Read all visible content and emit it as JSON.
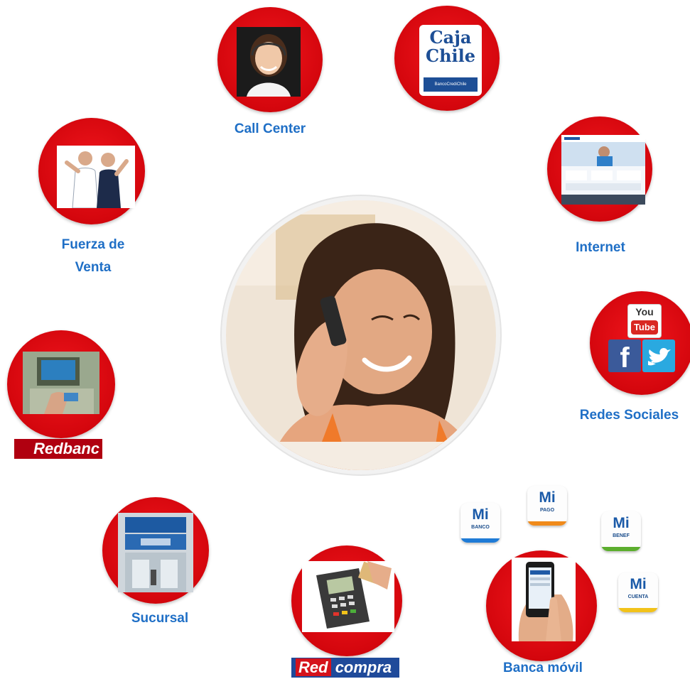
{
  "center": {
    "subject": "woman-on-phone"
  },
  "channels": {
    "call_center": {
      "label": "Call Center"
    },
    "caja_chile": {
      "line1": "Caja",
      "line2": "Chile",
      "footer": "BancoCrediChile"
    },
    "fuerza_venta": {
      "line1": "Fuerza de",
      "line2": "Venta"
    },
    "internet": {
      "label": "Internet"
    },
    "redes_sociales": {
      "label": "Redes Sociales",
      "youtube_top": "You",
      "youtube_bottom": "Tube"
    },
    "redbanc": {
      "brand": "Redbanc"
    },
    "sucursal": {
      "label": "Sucursal"
    },
    "redcompra": {
      "brand_red": "Red",
      "brand_compra": "compra"
    },
    "banca_movil": {
      "label": "Banca móvil"
    }
  },
  "mi_apps": [
    {
      "mi": "Mi",
      "sub": "BANCO",
      "color": "#1f7bd6"
    },
    {
      "mi": "Mi",
      "sub": "PAGO",
      "color": "#f08a1a"
    },
    {
      "mi": "Mi",
      "sub": "BENEF",
      "color": "#5cae2e"
    },
    {
      "mi": "Mi",
      "sub": "CUENTA",
      "color": "#f2c21a"
    }
  ],
  "colors": {
    "accent_red": "#d4060d",
    "label_blue": "#1f6fc6"
  }
}
